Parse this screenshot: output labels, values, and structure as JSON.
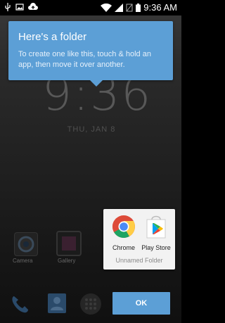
{
  "status_bar": {
    "time": "9:36 AM",
    "icons": [
      "usb-icon",
      "image-icon",
      "cloud-upload-icon",
      "wifi-icon",
      "signal-icon",
      "no-sim-icon",
      "battery-icon"
    ]
  },
  "lockscreen": {
    "clock": "9:36",
    "date": "THU, JAN 8"
  },
  "tooltip": {
    "title": "Here's a folder",
    "body": "To create one like this, touch & hold an app, then move it over another."
  },
  "folder": {
    "apps": [
      {
        "label": "Chrome",
        "icon": "chrome-icon"
      },
      {
        "label": "Play Store",
        "icon": "play-store-icon"
      }
    ],
    "name": "Unnamed Folder"
  },
  "background_apps": {
    "labels": [
      "Camera",
      "Gallery"
    ]
  },
  "dock": {
    "icons": [
      "phone-icon",
      "contacts-icon",
      "all-apps-icon"
    ]
  },
  "ok_button": {
    "label": "OK"
  },
  "colors": {
    "accent": "#5c9fd6",
    "folder_bg": "#f2f2f2"
  }
}
